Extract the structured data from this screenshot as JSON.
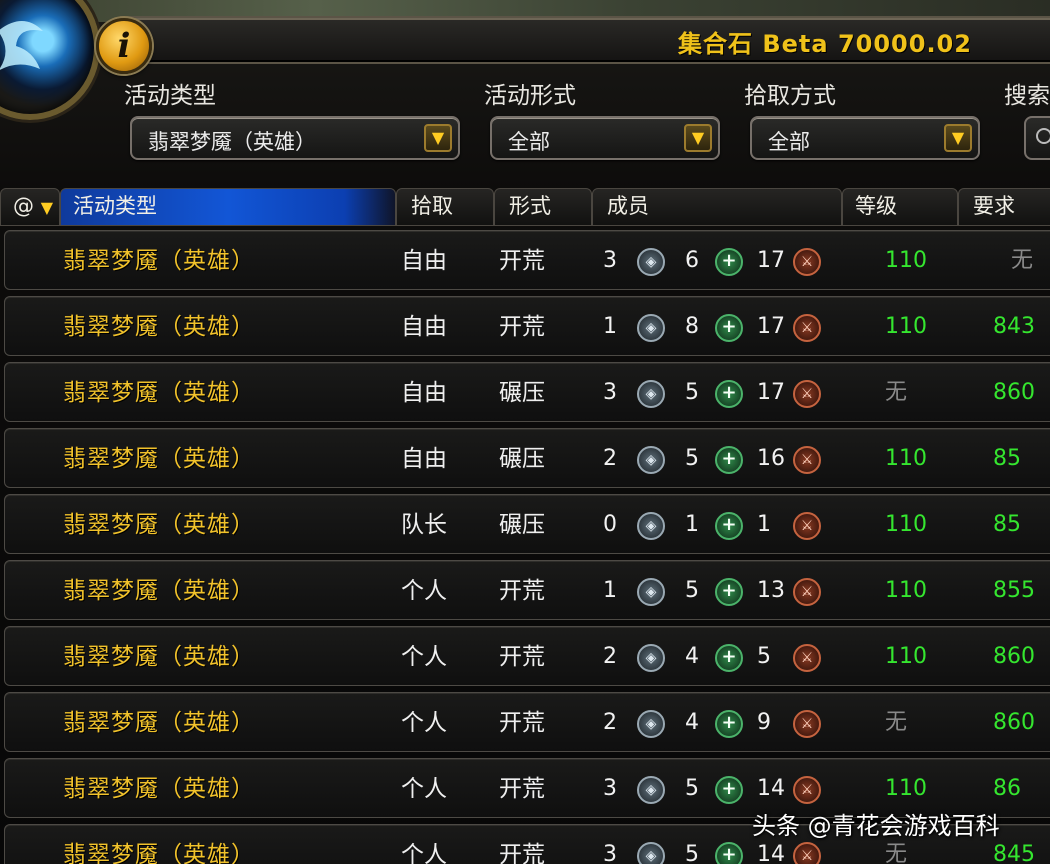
{
  "header": {
    "version_label": "集合石 Beta 70000.02",
    "info_icon_glyph": "i"
  },
  "filters": {
    "activity_type": {
      "label": "活动类型",
      "value": "翡翠梦魇（英雄）"
    },
    "activity_mode": {
      "label": "活动形式",
      "value": "全部"
    },
    "loot_mode": {
      "label": "拾取方式",
      "value": "全部"
    },
    "search": {
      "label": "搜索"
    }
  },
  "columns": {
    "at": "@",
    "activity": "活动类型",
    "loot": "拾取",
    "mode": "形式",
    "members": "成员",
    "level": "等级",
    "requirement": "要求"
  },
  "rows": [
    {
      "activity": "翡翠梦魇（英雄）",
      "loot": "自由",
      "mode": "开荒",
      "tank": "3",
      "healer": "6",
      "dps": "17",
      "level": "110",
      "requirement": "无"
    },
    {
      "activity": "翡翠梦魇（英雄）",
      "loot": "自由",
      "mode": "开荒",
      "tank": "1",
      "healer": "8",
      "dps": "17",
      "level": "110",
      "requirement": "843"
    },
    {
      "activity": "翡翠梦魇（英雄）",
      "loot": "自由",
      "mode": "碾压",
      "tank": "3",
      "healer": "5",
      "dps": "17",
      "level": "无",
      "requirement": "860"
    },
    {
      "activity": "翡翠梦魇（英雄）",
      "loot": "自由",
      "mode": "碾压",
      "tank": "2",
      "healer": "5",
      "dps": "16",
      "level": "110",
      "requirement": "85"
    },
    {
      "activity": "翡翠梦魇（英雄）",
      "loot": "队长",
      "mode": "碾压",
      "tank": "0",
      "healer": "1",
      "dps": "1",
      "level": "110",
      "requirement": "85"
    },
    {
      "activity": "翡翠梦魇（英雄）",
      "loot": "个人",
      "mode": "开荒",
      "tank": "1",
      "healer": "5",
      "dps": "13",
      "level": "110",
      "requirement": "855"
    },
    {
      "activity": "翡翠梦魇（英雄）",
      "loot": "个人",
      "mode": "开荒",
      "tank": "2",
      "healer": "4",
      "dps": "5",
      "level": "110",
      "requirement": "860"
    },
    {
      "activity": "翡翠梦魇（英雄）",
      "loot": "个人",
      "mode": "开荒",
      "tank": "2",
      "healer": "4",
      "dps": "9",
      "level": "无",
      "requirement": "860"
    },
    {
      "activity": "翡翠梦魇（英雄）",
      "loot": "个人",
      "mode": "开荒",
      "tank": "3",
      "healer": "5",
      "dps": "14",
      "level": "110",
      "requirement": "86"
    },
    {
      "activity": "翡翠梦魇（英雄）",
      "loot": "个人",
      "mode": "开荒",
      "tank": "3",
      "healer": "5",
      "dps": "14",
      "level": "无",
      "requirement": "845"
    }
  ],
  "icons": {
    "tank": "tank-shield-icon",
    "healer": "healer-plus-icon",
    "dps": "dps-sword-icon"
  },
  "colors": {
    "activity_text": "#f1c22b",
    "level_green": "#35e62f",
    "none_gray": "#8a8a8a",
    "sorted_header_blue": "#1256d6",
    "version_gold": "#f0c21a"
  },
  "watermark": "头条 @青花会游戏百科"
}
